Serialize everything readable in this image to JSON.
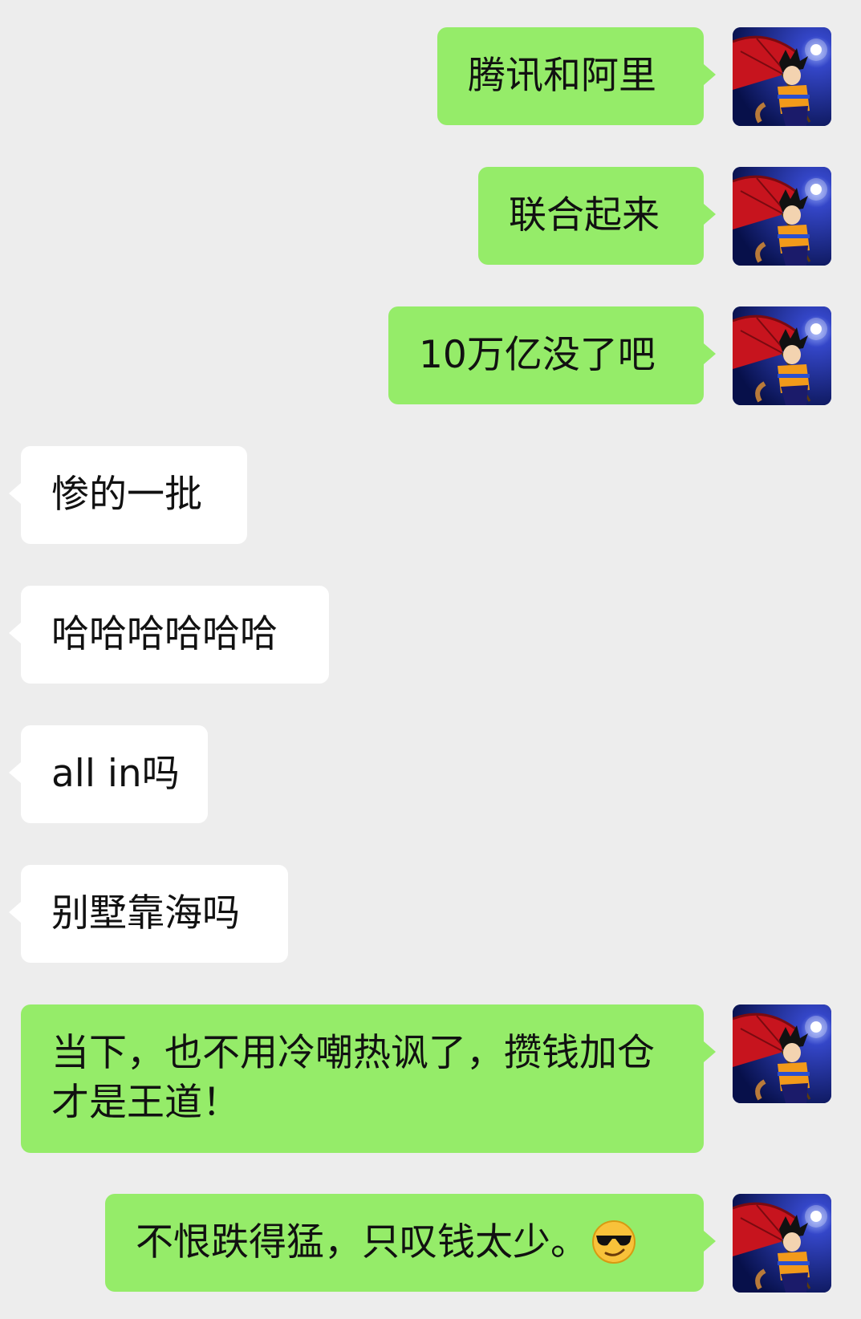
{
  "chat": {
    "messages": [
      {
        "side": "out",
        "text": "腾讯和阿里"
      },
      {
        "side": "out",
        "text": "联合起来"
      },
      {
        "side": "out",
        "text": "10万亿没了吧"
      },
      {
        "side": "in",
        "text": "惨的一批"
      },
      {
        "side": "in",
        "text": "哈哈哈哈哈哈"
      },
      {
        "side": "in",
        "text": "all in吗"
      },
      {
        "side": "in",
        "text": "别墅靠海吗"
      },
      {
        "side": "out",
        "text": "当下，也不用冷嘲热讽了，攒钱加仓才是王道！"
      },
      {
        "side": "out",
        "text": "不恨跌得猛，只叹钱太少。",
        "emoji": "sunglasses-emoji"
      }
    ],
    "self_avatar_icon": "goku-umbrella-avatar",
    "colors": {
      "background": "#ededed",
      "outgoing_bubble": "#95ec69",
      "incoming_bubble": "#ffffff"
    }
  }
}
